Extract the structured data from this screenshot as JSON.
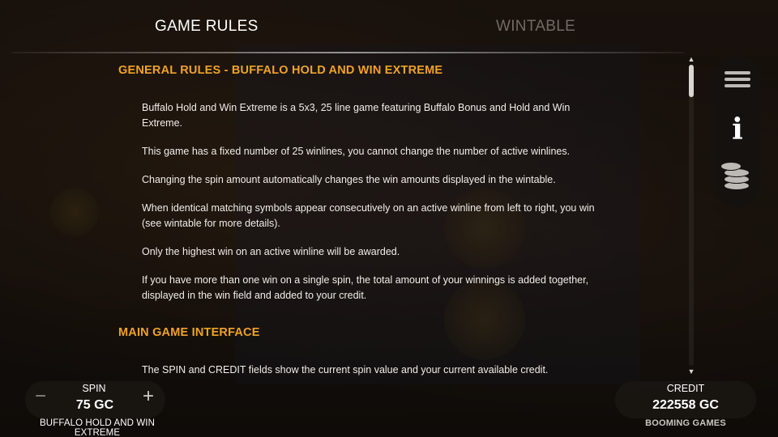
{
  "tabs": {
    "game_rules": "GAME RULES",
    "wintable": "WINTABLE"
  },
  "content": {
    "sections": [
      {
        "title": "GENERAL RULES - BUFFALO HOLD AND WIN EXTREME",
        "paragraphs": [
          "Buffalo Hold and Win Extreme is a 5x3, 25 line game featuring Buffalo Bonus and Hold and Win Extreme.",
          "This game has a fixed number of 25 winlines, you cannot change the number of active winlines.",
          "Changing the spin amount automatically changes the win amounts displayed in the wintable.",
          "When identical matching symbols appear consecutively on an active winline from left to right, you win (see wintable for more details).",
          "Only the highest win on an active winline will be awarded.",
          "If you have more than one win on a single spin, the total amount of your winnings is added together, displayed in the win field and added to your credit."
        ]
      },
      {
        "title": "MAIN GAME INTERFACE",
        "paragraphs": [
          "The SPIN and CREDIT fields show the current spin value and your current available credit."
        ]
      }
    ]
  },
  "side_menu": {
    "items": [
      "menu-icon",
      "info-icon",
      "coins-icon"
    ]
  },
  "bottom": {
    "spin_label": "SPIN",
    "spin_value": "75 GC",
    "minus": "−",
    "plus": "+",
    "credit_label": "CREDIT",
    "credit_value": "222558 GC",
    "game_name": "BUFFALO HOLD AND WIN EXTREME",
    "brand": "BOOMING GAMES"
  },
  "colors": {
    "accent": "#f0a326",
    "inactive_tab": "#6f6a66"
  }
}
